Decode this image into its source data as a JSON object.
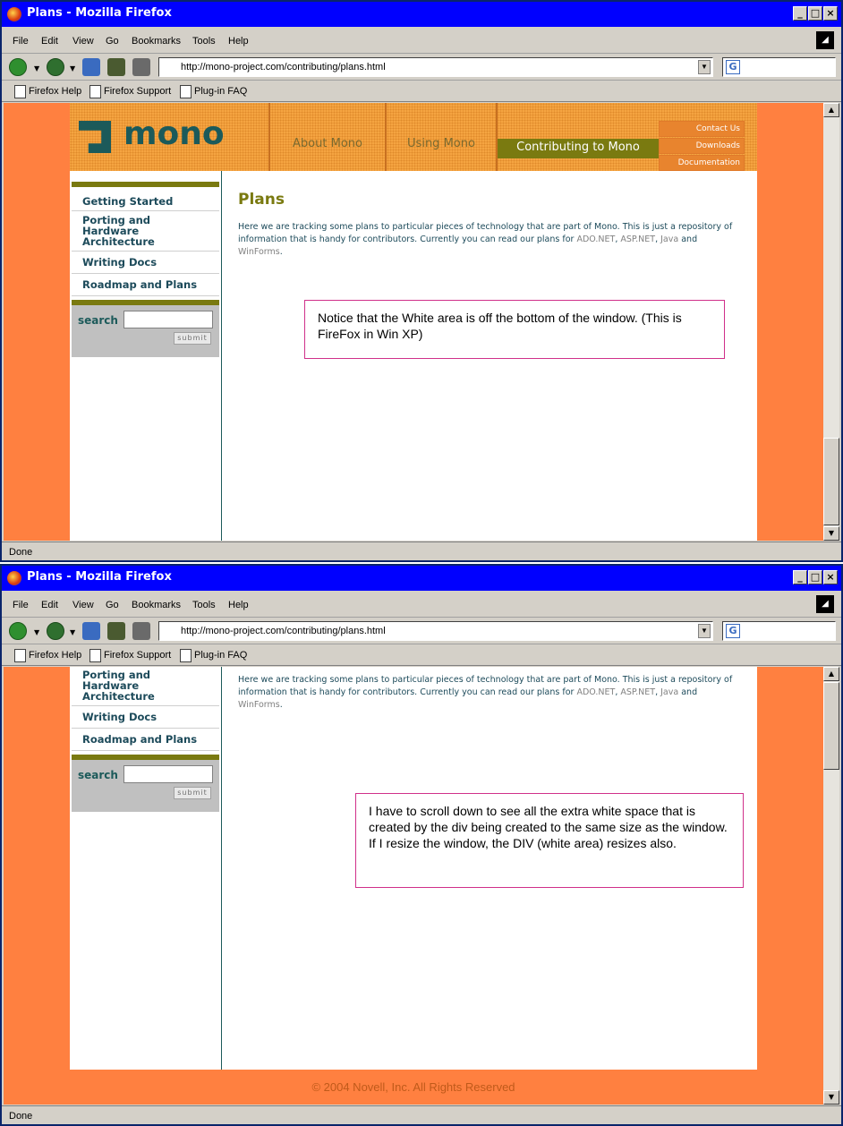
{
  "window": {
    "title": "Plans - Mozilla Firefox",
    "controls": [
      "_",
      "□",
      "×"
    ]
  },
  "menu": {
    "file": "File",
    "edit": "Edit",
    "view": "View",
    "go": "Go",
    "bookmarks": "Bookmarks",
    "tools": "Tools",
    "help": "Help"
  },
  "nav": {
    "url": "http://mono-project.com/contributing/plans.html",
    "search_icon": "G"
  },
  "bookmarks_bar": {
    "items": [
      "Firefox Help",
      "Firefox Support",
      "Plug-in FAQ"
    ]
  },
  "status": "Done",
  "site": {
    "logo": "mono",
    "tabs": [
      "About Mono",
      "Using Mono",
      "Contributing to Mono"
    ],
    "right_links": [
      "Contact Us",
      "Downloads",
      "Documentation"
    ],
    "sidebar": [
      "Getting Started",
      "Porting and Hardware Architecture",
      "Writing Docs",
      "Roadmap and Plans"
    ],
    "search_label": "search",
    "submit_label": "submit",
    "page_title": "Plans",
    "intro_text": "Here we are tracking some plans to particular pieces of technology that are part of Mono. This is just a repository of information that is handy for contributors. Currently you can read our plans for",
    "links": [
      "ADO.NET",
      "ASP.NET",
      "Java",
      "WinForms"
    ],
    "and_text": "and",
    "footer": "© 2004 Novell, Inc. All Rights Reserved"
  },
  "notes": {
    "note1": "Notice that the White area is off the bottom of the window.  (This is FireFox in Win XP)",
    "note2": "I have to scroll down to see all the extra white space that is created by the div being created to the same size as the window.  If I resize the window, the DIV (white area) resizes also."
  }
}
